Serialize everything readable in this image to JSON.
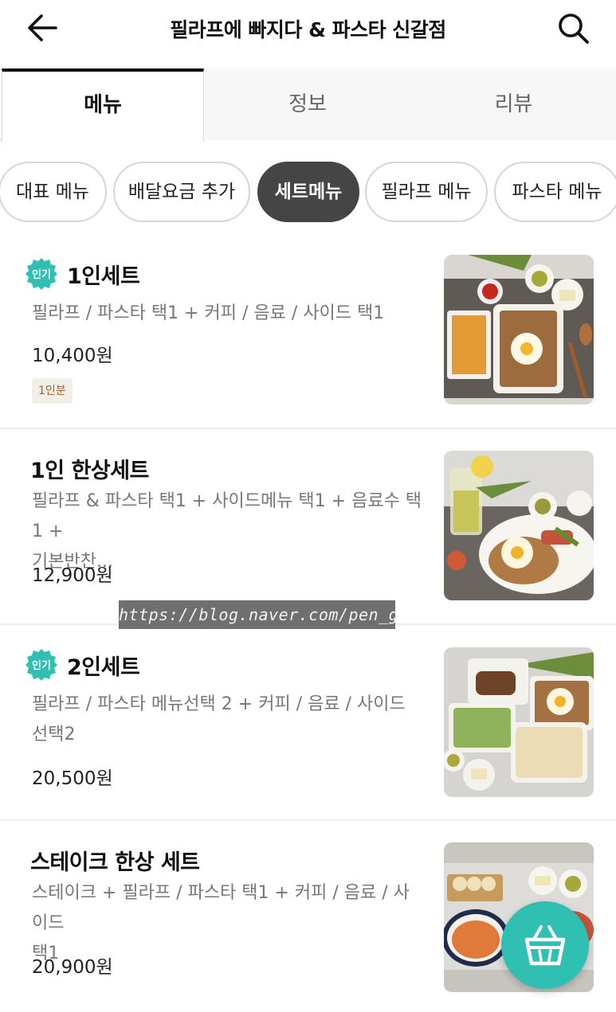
{
  "header": {
    "title": "필라프에 빠지다 & 파스타 신갈점",
    "back_icon": "arrow-left-icon",
    "search_icon": "search-icon"
  },
  "tabs": [
    {
      "label": "메뉴",
      "active": true
    },
    {
      "label": "정보",
      "active": false
    },
    {
      "label": "리뷰",
      "active": false
    }
  ],
  "categories": [
    {
      "label": "대표 메뉴",
      "active": false
    },
    {
      "label": "배달요금 추가",
      "active": false
    },
    {
      "label": "세트메뉴",
      "active": true
    },
    {
      "label": "필라프 메뉴",
      "active": false
    },
    {
      "label": "파스타 메뉴",
      "active": false
    }
  ],
  "popular_badge": "인기",
  "items": [
    {
      "name": "1인세트",
      "popular": true,
      "desc_lines": [
        "필라프 / 파스타 택1 + 커피 / 음료 / 사이드 택1"
      ],
      "price": "10,400원",
      "tag": "1인분"
    },
    {
      "name": "1인 한상세트",
      "popular": false,
      "desc_lines": [
        "필라프 & 파스타 택1 + 사이드메뉴 택1 + 음료수 택1 +",
        "기본반찬..."
      ],
      "price": "12,900원"
    },
    {
      "name": "2인세트",
      "popular": true,
      "desc_lines": [
        "필라프 / 파스타 메뉴선택 2 + 커피 / 음료 / 사이드",
        "선택2"
      ],
      "price": "20,500원"
    },
    {
      "name": "스테이크 한상 세트",
      "popular": false,
      "desc_lines": [
        "스테이크 + 필라프 / 파스타 택1 + 커피 / 음료 / 사이드",
        "택1"
      ],
      "price": "20,900원"
    }
  ],
  "watermark": "https://blog.naver.com/pen_g",
  "cart_icon": "shopping-basket-icon",
  "colors": {
    "accent": "#2fbfb3",
    "active_chip": "#454545",
    "tag_text": "#a0622f",
    "tag_bg": "#f2efe9"
  }
}
